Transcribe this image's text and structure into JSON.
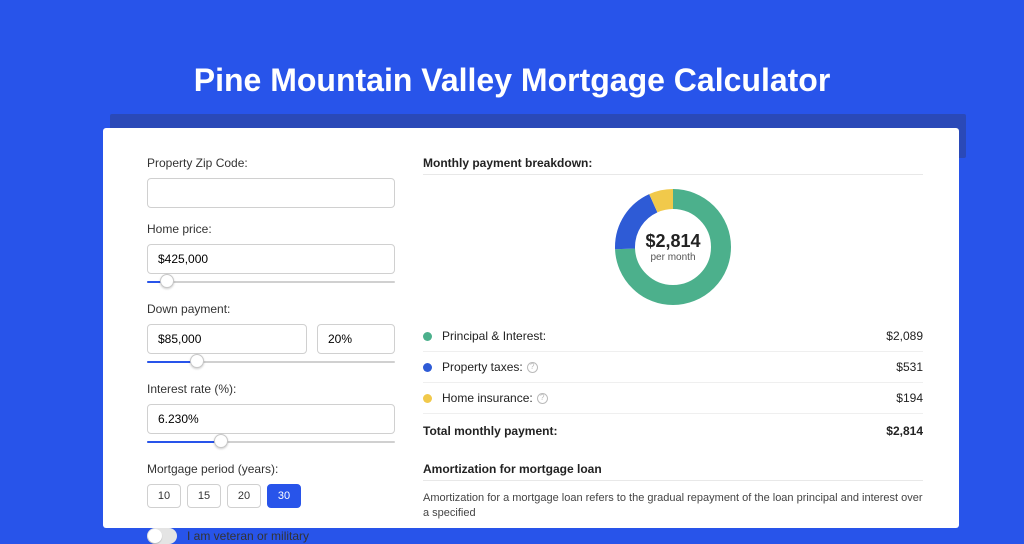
{
  "title": "Pine Mountain Valley Mortgage Calculator",
  "form": {
    "zip_label": "Property Zip Code:",
    "zip_value": "",
    "home_price_label": "Home price:",
    "home_price_value": "$425,000",
    "down_payment_label": "Down payment:",
    "down_payment_value": "$85,000",
    "down_payment_pct": "20%",
    "interest_label": "Interest rate (%):",
    "interest_value": "6.230%",
    "period_label": "Mortgage period (years):",
    "period_options": [
      "10",
      "15",
      "20",
      "30"
    ],
    "period_selected": "30",
    "veteran_label": "I am veteran or military",
    "veteran_value": false,
    "sliders": {
      "home_price_pct": 8,
      "down_payment_pct": 20,
      "interest_pct": 30
    }
  },
  "breakdown": {
    "heading": "Monthly payment breakdown:",
    "total": "$2,814",
    "sub": "per month",
    "items": [
      {
        "label": "Principal & Interest:",
        "value": "$2,089",
        "num": 2089,
        "color": "green",
        "info": false
      },
      {
        "label": "Property taxes:",
        "value": "$531",
        "num": 531,
        "color": "blue",
        "info": true
      },
      {
        "label": "Home insurance:",
        "value": "$194",
        "num": 194,
        "color": "yellow",
        "info": true
      }
    ],
    "total_label": "Total monthly payment:",
    "total_value": "$2,814"
  },
  "amort": {
    "heading": "Amortization for mortgage loan",
    "text": "Amortization for a mortgage loan refers to the gradual repayment of the loan principal and interest over a specified"
  },
  "chart_data": {
    "type": "pie",
    "title": "Monthly payment breakdown",
    "series": [
      {
        "name": "Principal & Interest",
        "value": 2089,
        "color": "#4cb08c"
      },
      {
        "name": "Property taxes",
        "value": 531,
        "color": "#2e5bd6"
      },
      {
        "name": "Home insurance",
        "value": 194,
        "color": "#f1c94b"
      }
    ],
    "total": 2814,
    "center_label": "$2,814",
    "center_sub": "per month"
  }
}
